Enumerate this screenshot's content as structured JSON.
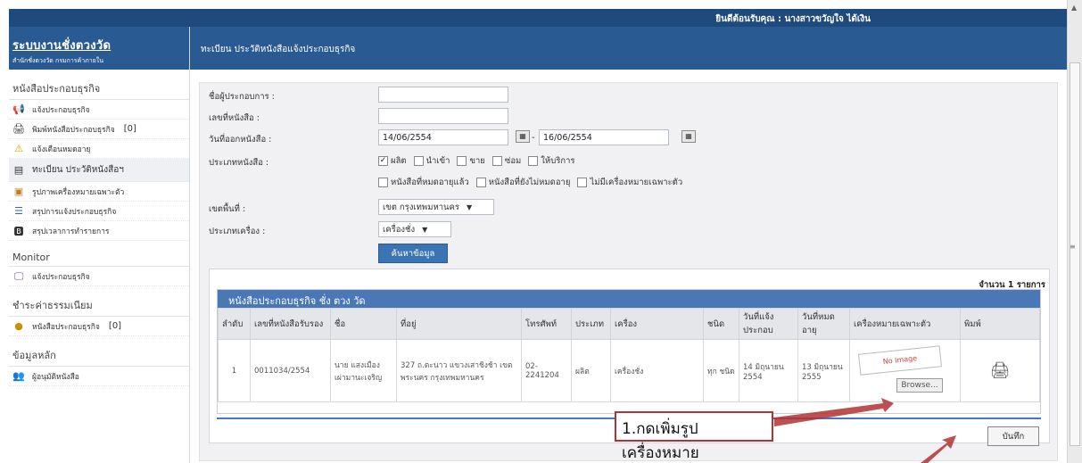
{
  "header": {
    "welcome": "ยินดีต้อนรับคุณ : นางสาวขวัญใจ ได้เงิน"
  },
  "brand": {
    "title": "ระบบงานชั่งตวงวัด",
    "subtitle": "สำนักชั่งตวงวัด กรมการค้าภายใน"
  },
  "sidebar": {
    "sections": [
      {
        "title": "หนังสือประกอบธุรกิจ",
        "items": [
          {
            "label": "แจ้งประกอบธุรกิจ",
            "icon": "megaphone-icon"
          },
          {
            "label": "พิมพ์หนังสือประกอบธุรกิจ",
            "count": "[0]",
            "icon": "printer-icon"
          },
          {
            "label": "แจ้งเตือนหมดอายุ",
            "icon": "warning-icon"
          },
          {
            "label": "ทะเบียน ประวัติหนังสือฯ",
            "icon": "document-icon",
            "active": true
          },
          {
            "label": "รูปภาพเครื่องหมายเฉพาะตัว",
            "icon": "image-icon"
          },
          {
            "label": "สรุปการแจ้งประกอบธุรกิจ",
            "icon": "list-icon"
          },
          {
            "label": "สรุปเวลาการทำรายการ",
            "icon": "report-icon"
          }
        ]
      },
      {
        "title": "Monitor",
        "items": [
          {
            "label": "แจ้งประกอบธุรกิจ",
            "icon": "monitor-icon"
          }
        ]
      },
      {
        "title": "ชำระค่าธรรมเนียม",
        "items": [
          {
            "label": "หนังสือประกอบธุรกิจ",
            "count": "[0]",
            "icon": "coins-icon"
          }
        ]
      },
      {
        "title": "ข้อมูลหลัก",
        "items": [
          {
            "label": "ผู้อนุมัติหนังสือ",
            "icon": "users-icon"
          }
        ]
      }
    ]
  },
  "main": {
    "title": "ทะเบียน ประวัติหนังสือแจ้งประกอบธุรกิจ"
  },
  "form": {
    "operator_label": "ชื่อผู้ประกอบการ :",
    "doc_no_label": "เลขที่หนังสือ :",
    "issue_date_label": "วันที่ออกหนังสือ :",
    "date_from": "14/06/2554",
    "date_to": "16/06/2554",
    "doc_type_label": "ประเภทหนังสือ :",
    "doc_types": [
      "ผลิต",
      "นำเข้า",
      "ขาย",
      "ซ่อม",
      "ให้บริการ"
    ],
    "doc_types_checked": [
      true,
      false,
      false,
      false,
      false
    ],
    "status_options": [
      "หนังสือที่หมดอายุแล้ว",
      "หนังสือที่ยังไม่หมดอายุ",
      "ไม่มีเครื่องหมายเฉพาะตัว"
    ],
    "area_label": "เขตพื้นที่ :",
    "area_value": "เขต กรุงเทพมหานคร",
    "device_type_label": "ประเภทเครื่อง :",
    "device_type_value": "เครื่องชั่ง",
    "search_button": "ค้นหาข้อมูล"
  },
  "results": {
    "count_text": "จำนวน 1 รายการ",
    "table_title": "หนังสือประกอบธุรกิจ ชั่ง ตวง วัด",
    "columns": [
      "ลำดับ",
      "เลขที่หนังสือรับรอง",
      "ชื่อ",
      "ที่อยู่",
      "โทรศัพท์",
      "ประเภท",
      "เครื่อง",
      "ชนิด",
      "วันที่แจ้งประกอบ",
      "วันที่หมดอายุ",
      "เครื่องหมายเฉพาะตัว",
      "พิมพ์"
    ],
    "rows": [
      [
        "1",
        "0011034/2554",
        "นาย แสงเมือง เผ่ามานะเจริญ",
        "327 ถ.ตะนาว แขวงเสาชิงช้า เขตพระนคร กรุงเทพมหานคร",
        "02-2241204",
        "ผลิต",
        "เครื่องชั่ง",
        "ทุก ชนิด",
        "14 มิถุนายน 2554",
        "13 มิถุนายน 2555"
      ]
    ],
    "no_image_text": "No Image",
    "browse_button": "Browse...",
    "save_button": "บันทึก"
  },
  "annotation": {
    "callout_text": "1.กดเพิ่มรูปเครื่องหมาย",
    "color": "#b23333"
  }
}
